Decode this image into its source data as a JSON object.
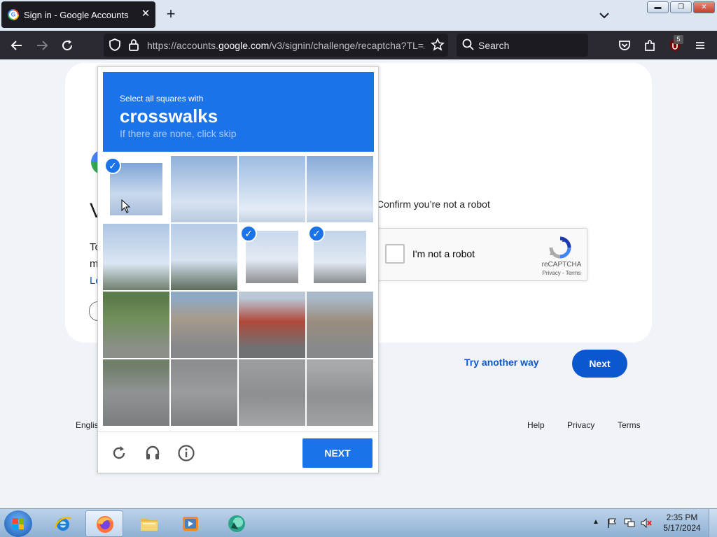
{
  "browser": {
    "tab_title": "Sign in - Google Accounts",
    "url_prefix": "https://accounts.",
    "url_domain": "google.com",
    "url_path": "/v3/signin/challenge/recaptcha?TL=A",
    "search_placeholder": "Search",
    "extension_badge": "5"
  },
  "page": {
    "partial_heading": "V",
    "partial_line1": "To",
    "partial_line2": "m",
    "partial_link": "Le",
    "confirm_text": "Confirm you’re not a robot",
    "checkbox_label": "I'm not a robot",
    "recaptcha_brand": "reCAPTCHA",
    "recaptcha_links": "Privacy - Terms",
    "try_another_way": "Try another way",
    "next_button": "Next",
    "footer": {
      "language": "Englis",
      "help": "Help",
      "privacy": "Privacy",
      "terms": "Terms"
    }
  },
  "challenge": {
    "instruction_small": "Select all squares with",
    "instruction_big": "crosswalks",
    "instruction_sub": "If there are none, click skip",
    "next_button": "NEXT",
    "grid_rows": 4,
    "grid_cols": 4,
    "selected_tiles": [
      0,
      6,
      7
    ],
    "footer_icons": [
      "reload-icon",
      "audio-icon",
      "info-icon"
    ]
  },
  "taskbar": {
    "apps": [
      "internet-explorer-icon",
      "firefox-icon",
      "file-explorer-icon",
      "media-player-icon",
      "app-icon"
    ],
    "time": "2:35 PM",
    "date": "5/17/2024"
  },
  "colors": {
    "challenge_blue": "#1a73e8",
    "google_blue": "#0b57d0",
    "firefox_dark": "#2b2a33"
  }
}
